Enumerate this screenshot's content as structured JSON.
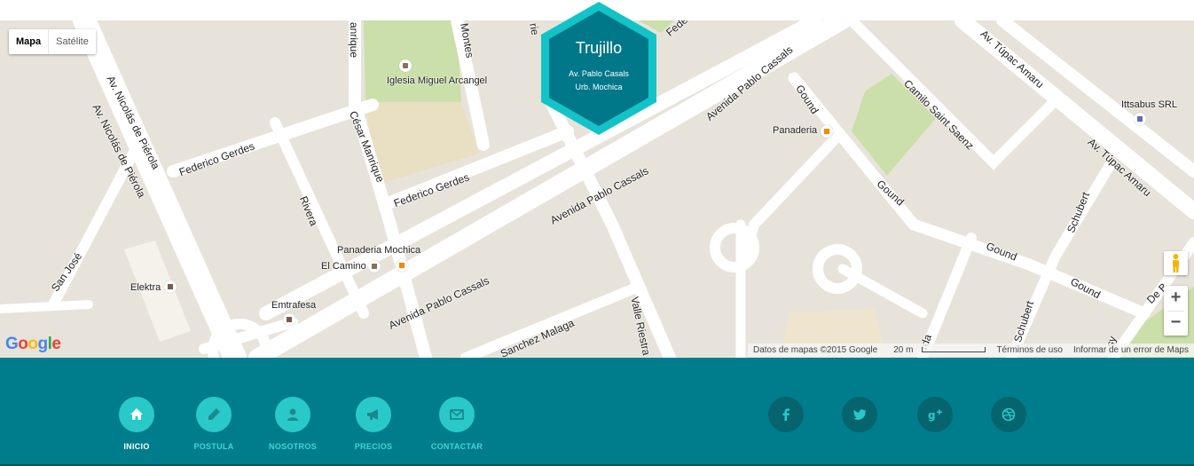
{
  "map": {
    "map_type": {
      "map": "Mapa",
      "satellite": "Satélite",
      "selected": "Mapa"
    },
    "streets": [
      "Av. Nicolás de Piérola",
      "Av. Nicolás de Piérola",
      "Federico Gerdes",
      "Federico Gerdes",
      "Rivera",
      "César Manrique",
      "anrique",
      "Montes",
      "Avenida Pablo Cassals",
      "Avenida Pablo Cassals",
      "Avenida Pablo Cassals",
      "Camilo Saint Saenz",
      "Gound",
      "Gound",
      "Gound",
      "Gound",
      "Av. Túpac Amaru",
      "Av. Túpac Amaru",
      "Schubert",
      "Schubert",
      "San José",
      "Sanchez Malaga",
      "Valle Riestra",
      "Fede",
      "De B",
      "rda",
      "sy",
      "rie"
    ],
    "places": {
      "iglesia": "Iglesia Miguel Arcangel",
      "panaderia_mochica": "Panaderia Mochica",
      "el_camino": "El Camino",
      "elektra": "Elektra",
      "emtrafesa": "Emtrafesa",
      "panaderia": "Panaderia",
      "ittsabus": "Ittsabus SRL"
    },
    "attribution": {
      "data": "Datos de mapas ©2015 Google",
      "scale": "20 m",
      "terms": "Términos de uso",
      "report": "Informar de un error de Maps"
    },
    "logo": "Google",
    "zoom_in": "+",
    "zoom_out": "−"
  },
  "marker": {
    "city": "Trujillo",
    "line1": "Av. Pablo Casals",
    "line2": "Urb. Mochica",
    "fill": "#00788a",
    "border": "#12c4c8"
  },
  "footer": {
    "background": "#007d8c",
    "nav": [
      {
        "label": "INICIO",
        "icon": "home-icon",
        "active": true
      },
      {
        "label": "POSTULA",
        "icon": "pencil-icon",
        "active": false
      },
      {
        "label": "NOSOTROS",
        "icon": "user-icon",
        "active": false
      },
      {
        "label": "PRECIOS",
        "icon": "megaphone-icon",
        "active": false
      },
      {
        "label": "CONTACTAR",
        "icon": "envelope-icon",
        "active": false
      }
    ],
    "social": [
      {
        "icon": "facebook-icon"
      },
      {
        "icon": "twitter-icon"
      },
      {
        "icon": "google-plus-icon"
      },
      {
        "icon": "dribbble-icon"
      }
    ]
  }
}
